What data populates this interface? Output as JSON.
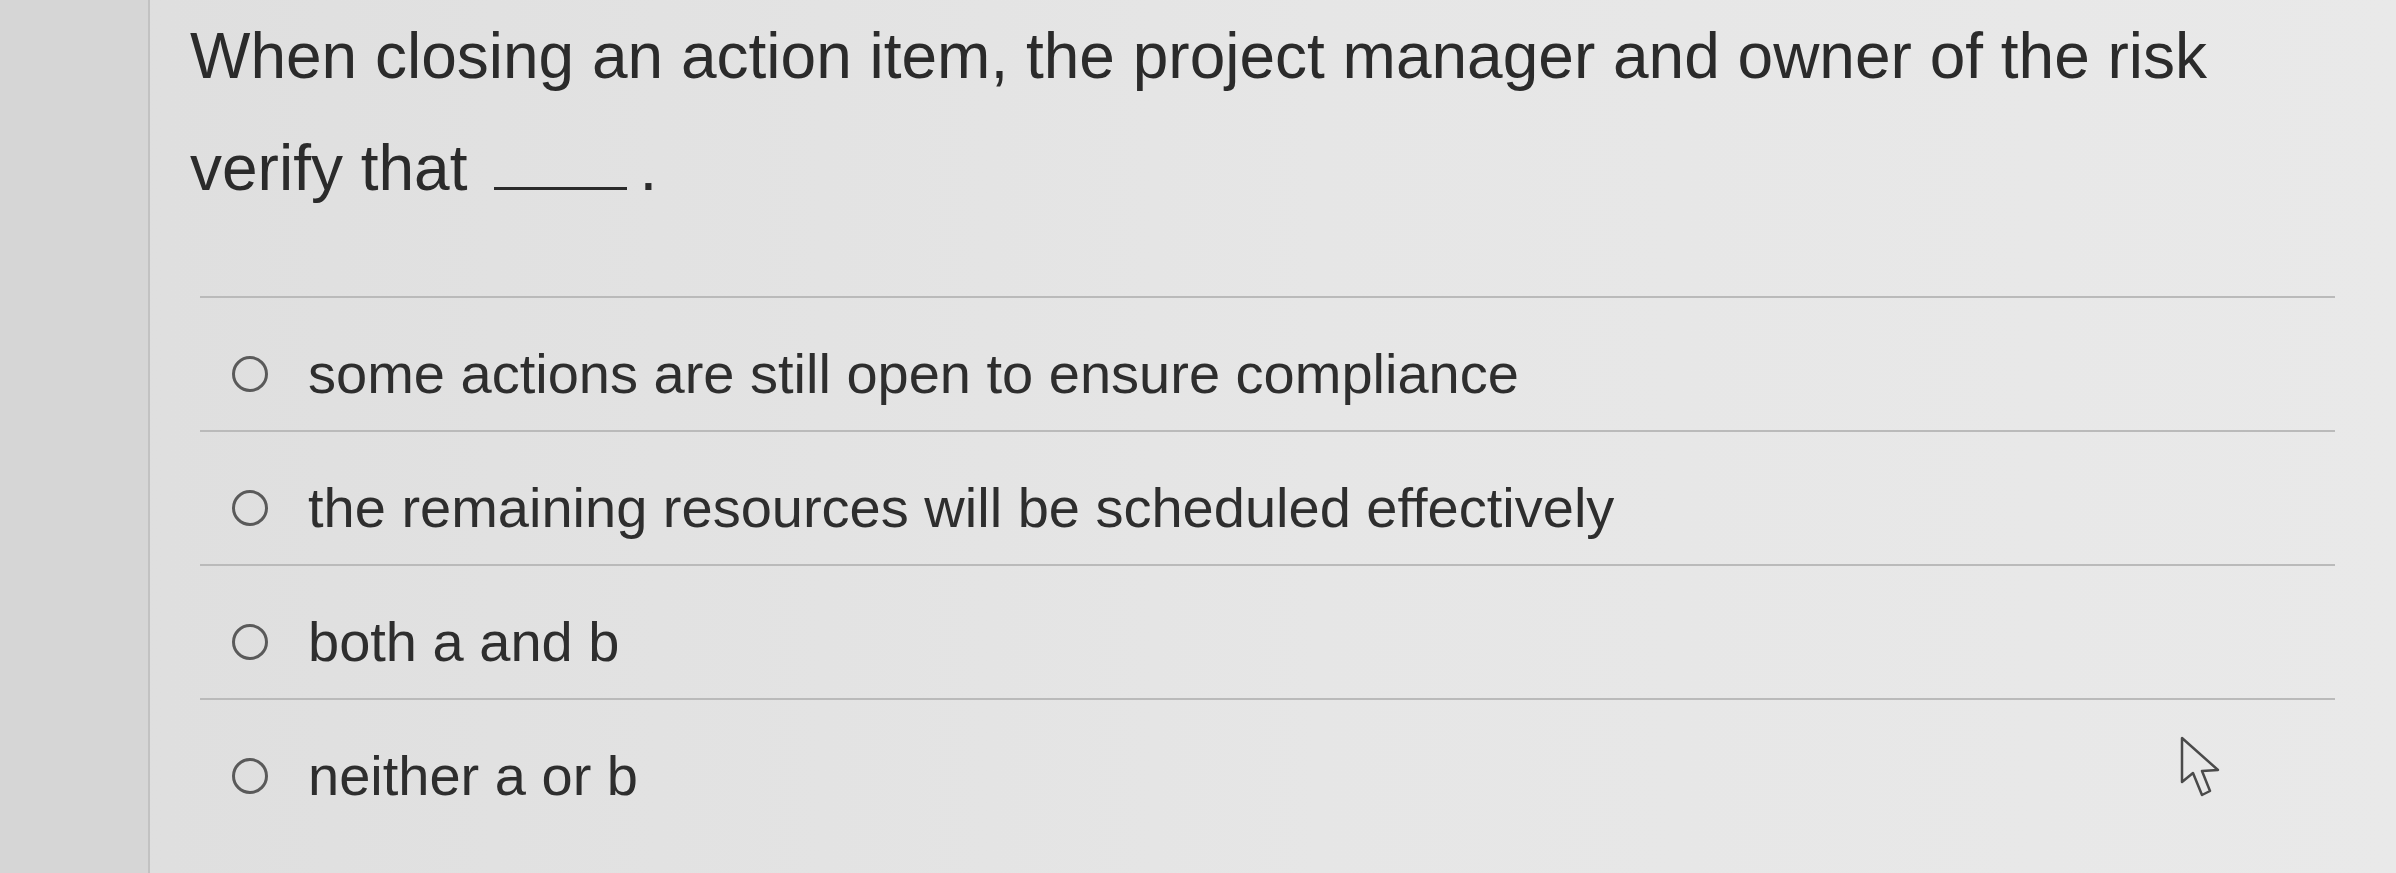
{
  "question": {
    "parts": [
      {
        "kind": "text",
        "text": "When closing an action item, the project manager and owner of the risk verify that"
      },
      {
        "kind": "blank"
      },
      {
        "kind": "text",
        "text": "."
      }
    ]
  },
  "options": [
    {
      "label": "some actions are still open to ensure compliance",
      "selected": false
    },
    {
      "label": "the remaining resources will be scheduled effectively",
      "selected": false
    },
    {
      "label": "both a and b",
      "selected": false
    },
    {
      "label": "neither a or b",
      "selected": false
    }
  ]
}
